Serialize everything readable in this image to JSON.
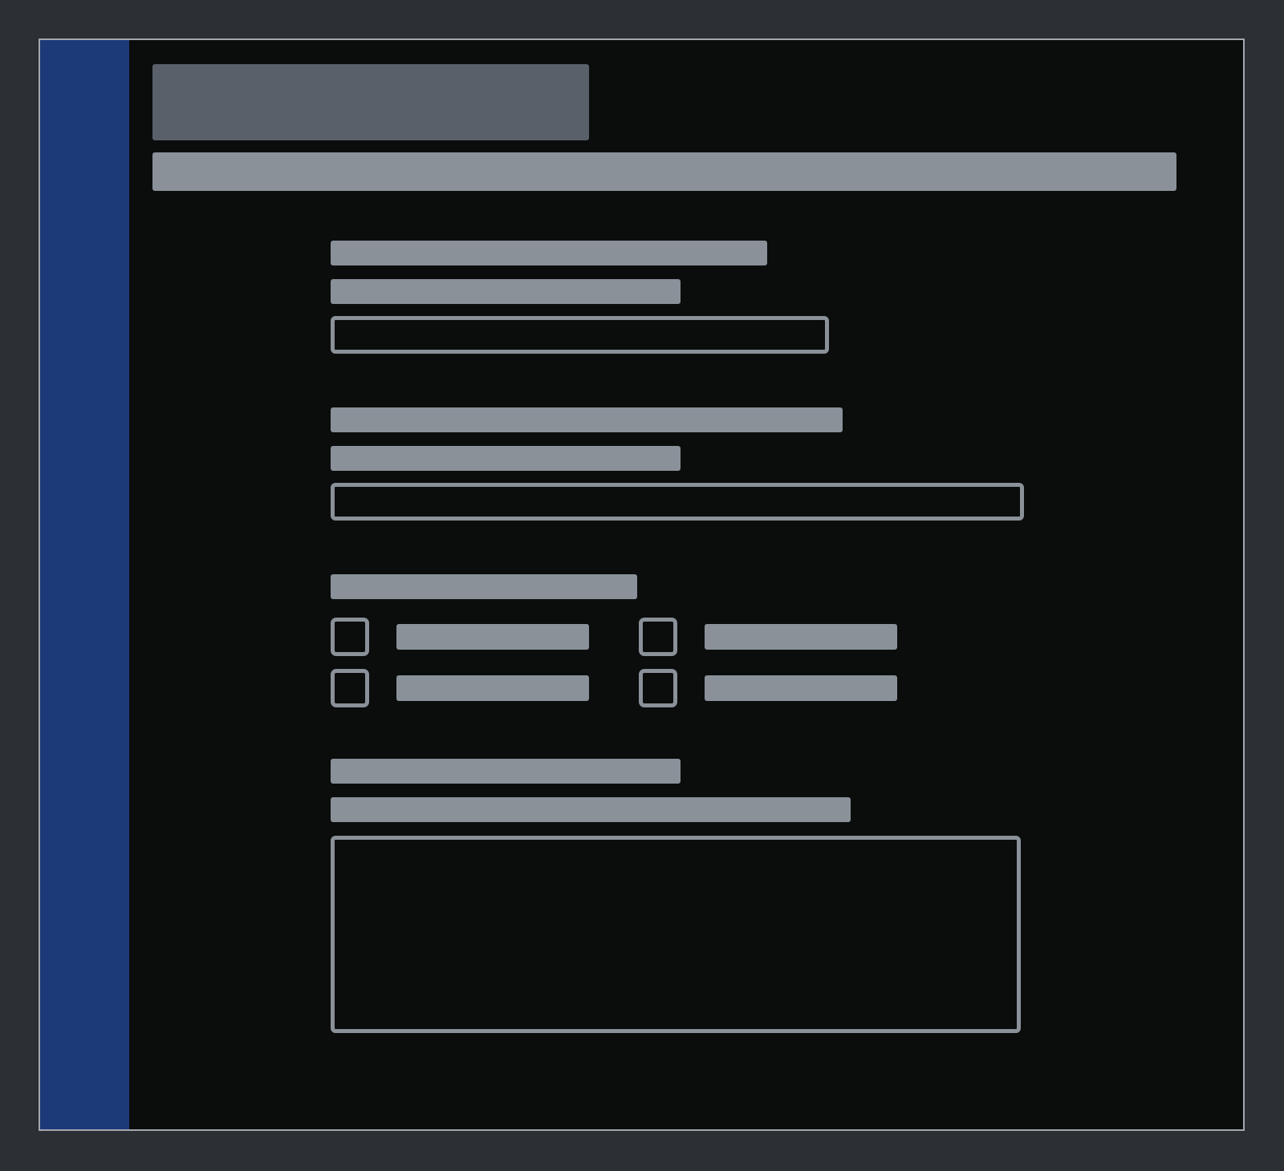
{
  "colors": {
    "page_background": "#2c2f34",
    "window_background": "#0b0d0d",
    "window_border": "#a3a8af",
    "sidebar": "#1d3a78",
    "placeholder": "#8a9199",
    "title_placeholder": "#596069"
  },
  "header": {
    "title": "",
    "subtitle": ""
  },
  "form": {
    "section1": {
      "label": "",
      "helper": "",
      "input_value": ""
    },
    "section2": {
      "label": "",
      "helper": "",
      "input_value": ""
    },
    "section3": {
      "label": "",
      "options": [
        {
          "label": "",
          "checked": false
        },
        {
          "label": "",
          "checked": false
        },
        {
          "label": "",
          "checked": false
        },
        {
          "label": "",
          "checked": false
        }
      ]
    },
    "section4": {
      "label": "",
      "helper": "",
      "textarea_value": ""
    }
  }
}
